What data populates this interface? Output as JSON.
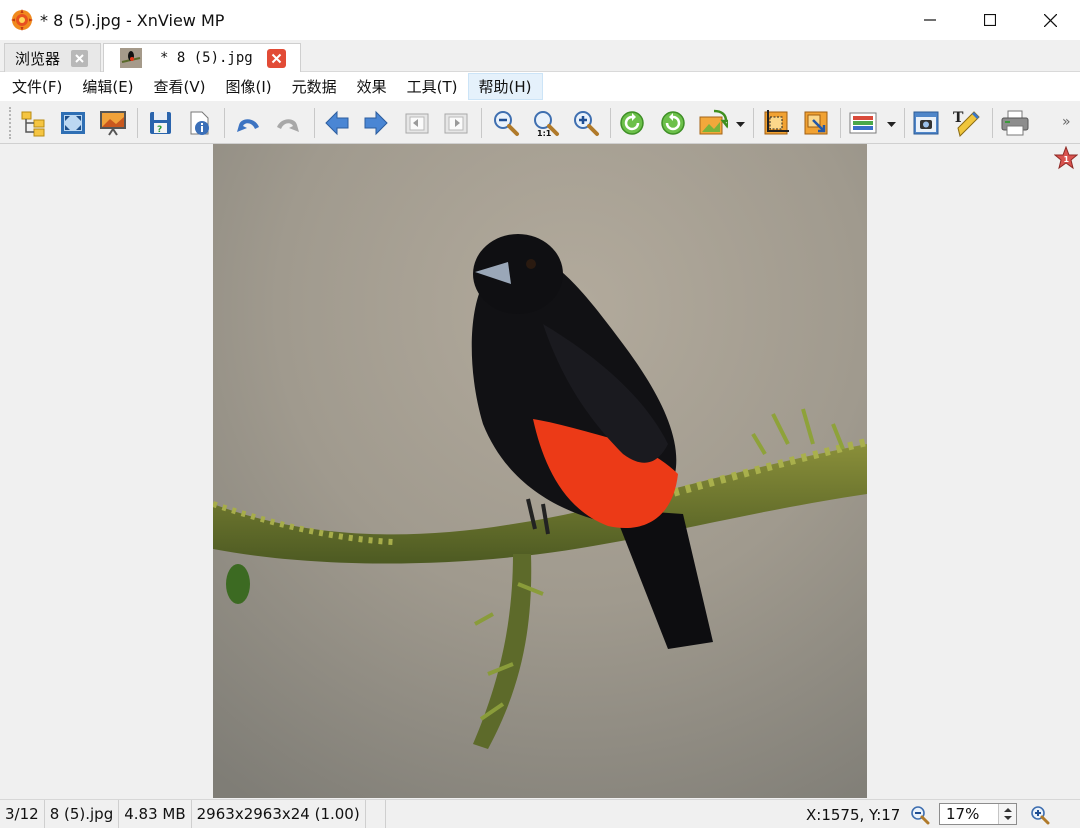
{
  "window": {
    "title": "* 8 (5).jpg - XnView MP",
    "app_icon": "xnview-logo-icon"
  },
  "tabs": [
    {
      "label": "浏览器",
      "icon": "close-icon"
    },
    {
      "label": "* 8 (5).jpg",
      "icon": "close-icon"
    }
  ],
  "menu": [
    {
      "label": "文件(F)"
    },
    {
      "label": "编辑(E)"
    },
    {
      "label": "查看(V)"
    },
    {
      "label": "图像(I)"
    },
    {
      "label": "元数据"
    },
    {
      "label": "效果"
    },
    {
      "label": "工具(T)"
    },
    {
      "label": "帮助(H)",
      "active": true
    }
  ],
  "toolbar": {
    "buttons": [
      "browser-tree-icon",
      "fit-window-icon",
      "slideshow-icon",
      "save-icon",
      "properties-icon",
      "undo-icon",
      "redo-icon",
      "previous-icon",
      "next-icon",
      "first-page-icon",
      "last-page-icon",
      "zoom-out-icon",
      "zoom-1to1-icon",
      "zoom-in-icon",
      "rotate-left-icon",
      "rotate-right-icon",
      "transform-icon",
      "crop-icon",
      "resize-icon",
      "adjust-colors-icon",
      "screenshot-icon",
      "annotate-icon",
      "print-icon"
    ]
  },
  "status": {
    "position": "3/12",
    "filename": "8 (5).jpg",
    "filesize": "4.83 MB",
    "dimensions": "2963x2963x24 (1.00)",
    "coords": "X:1575, Y:17",
    "zoom": "17%"
  },
  "colors": {
    "accent_close": "#e24b36",
    "menu_active": "#e5f1fb",
    "canvas_bg": "#f0f0f0"
  }
}
